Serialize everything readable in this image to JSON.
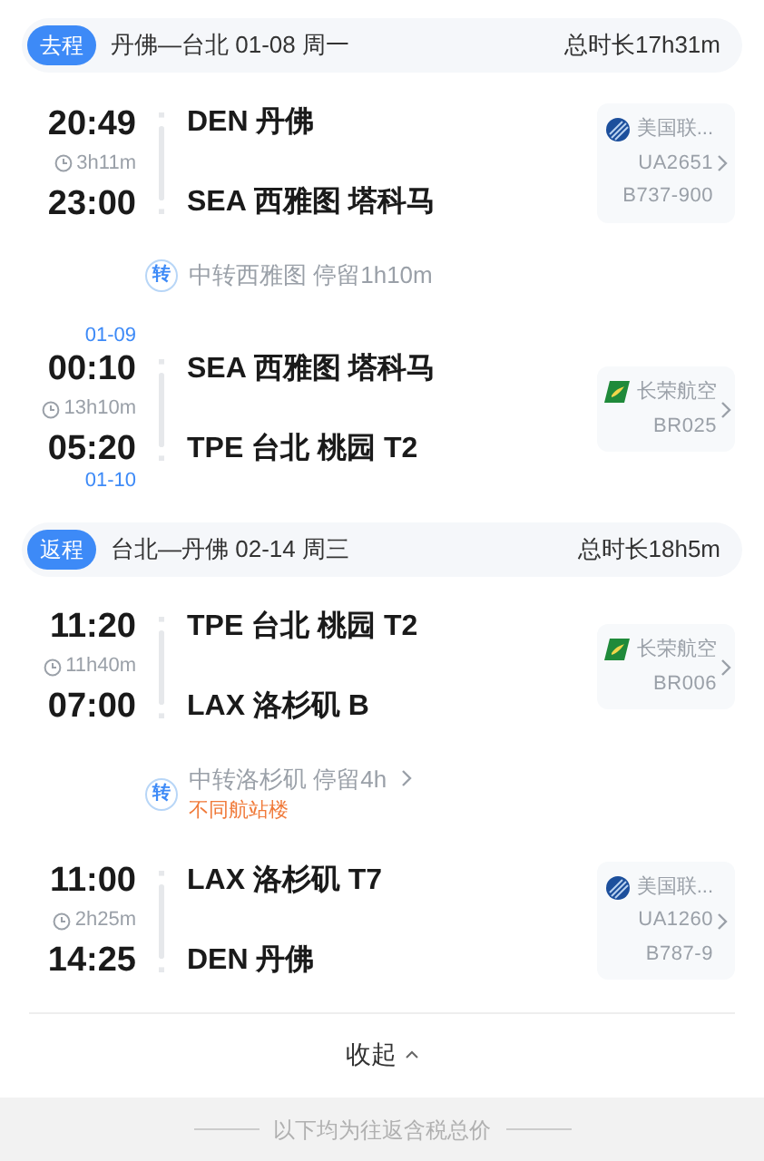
{
  "trips": [
    {
      "badge": "去程",
      "route": "丹佛—台北 01-08 周一",
      "total": "总时长17h31m",
      "items": [
        {
          "kind": "flight",
          "dep_time": "20:49",
          "duration": "3h11m",
          "arr_time": "23:00",
          "dep_airport": "DEN 丹佛",
          "arr_airport": "SEA 西雅图 塔科马",
          "airline": {
            "kind": "globe",
            "name": "美国联...",
            "flight": "UA2651",
            "aircraft": "B737-900"
          }
        },
        {
          "kind": "transfer",
          "icon": "转",
          "text": "中转西雅图 停留1h10m",
          "link": false
        },
        {
          "kind": "flight",
          "dep_date": "01-09",
          "dep_time": "00:10",
          "duration": "13h10m",
          "arr_time": "05:20",
          "arr_date": "01-10",
          "dep_airport": "SEA 西雅图 塔科马",
          "arr_airport": "TPE 台北 桃园 T2",
          "airline": {
            "kind": "wing",
            "name": "长荣航空",
            "flight": "BR025"
          }
        }
      ]
    },
    {
      "badge": "返程",
      "route": "台北—丹佛 02-14 周三",
      "total": "总时长18h5m",
      "items": [
        {
          "kind": "flight",
          "dep_time": "11:20",
          "duration": "11h40m",
          "arr_time": "07:00",
          "dep_airport": "TPE 台北 桃园 T2",
          "arr_airport": "LAX 洛杉矶 B",
          "airline": {
            "kind": "wing",
            "name": "长荣航空",
            "flight": "BR006"
          }
        },
        {
          "kind": "transfer",
          "icon": "转",
          "text": "中转洛杉矶 停留4h",
          "link": true,
          "warning": "不同航站楼"
        },
        {
          "kind": "flight",
          "dep_time": "11:00",
          "duration": "2h25m",
          "arr_time": "14:25",
          "dep_airport": "LAX 洛杉矶 T7",
          "arr_airport": "DEN 丹佛",
          "airline": {
            "kind": "globe",
            "name": "美国联...",
            "flight": "UA1260",
            "aircraft": "B787-9"
          }
        }
      ]
    }
  ],
  "collapse": "收起",
  "footer": "以下均为往返含税总价"
}
